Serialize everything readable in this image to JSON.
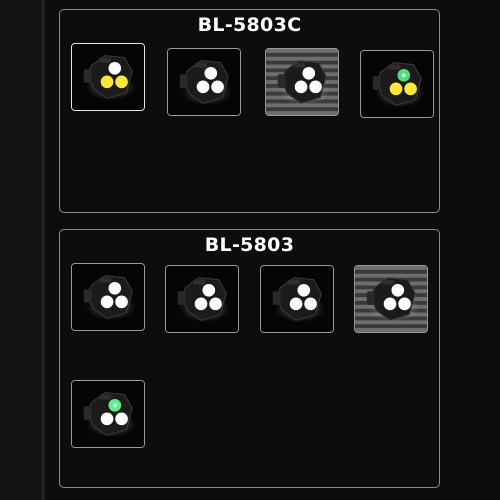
{
  "sections": [
    {
      "title": "BL-5803C",
      "variants": [
        {
          "name": "bl-5803c-white-yellow-cob",
          "lamps": [
            "#ffffff",
            "#ffe73a",
            "#ffe73a"
          ],
          "bg": "dark",
          "selected": true
        },
        {
          "name": "bl-5803c-white-floodlight",
          "lamps": [
            "#ffffff",
            "#ffffff",
            "#ffffff"
          ],
          "bg": "dark",
          "selected": false
        },
        {
          "name": "bl-5803c-white-striped",
          "lamps": [
            "#ffffff",
            "#ffffff",
            "#ffffff"
          ],
          "bg": "striped",
          "selected": false
        },
        {
          "name": "bl-5803c-green-yellow",
          "lamps": [
            "#4fe07a",
            "#ffe73a",
            "#ffe73a"
          ],
          "bg": "dark",
          "selected": false
        }
      ]
    },
    {
      "title": "BL-5803",
      "variants": [
        {
          "name": "bl-5803-white-dark",
          "lamps": [
            "#ffffff",
            "#ffffff",
            "#ffffff"
          ],
          "bg": "dark",
          "selected": false
        },
        {
          "name": "bl-5803-white-glow",
          "lamps": [
            "#ffffff",
            "#ffffff",
            "#ffffff"
          ],
          "bg": "dark",
          "selected": false
        },
        {
          "name": "bl-5803-white-bright",
          "lamps": [
            "#ffffff",
            "#ffffff",
            "#ffffff"
          ],
          "bg": "dark",
          "selected": false
        },
        {
          "name": "bl-5803-white-striped",
          "lamps": [
            "#ffffff",
            "#ffffff",
            "#ffffff"
          ],
          "bg": "striped",
          "selected": false
        },
        {
          "name": "bl-5803-green-white",
          "lamps": [
            "#5ef08a",
            "#ffffff",
            "#ffffff"
          ],
          "bg": "dark",
          "selected": false
        }
      ]
    }
  ]
}
